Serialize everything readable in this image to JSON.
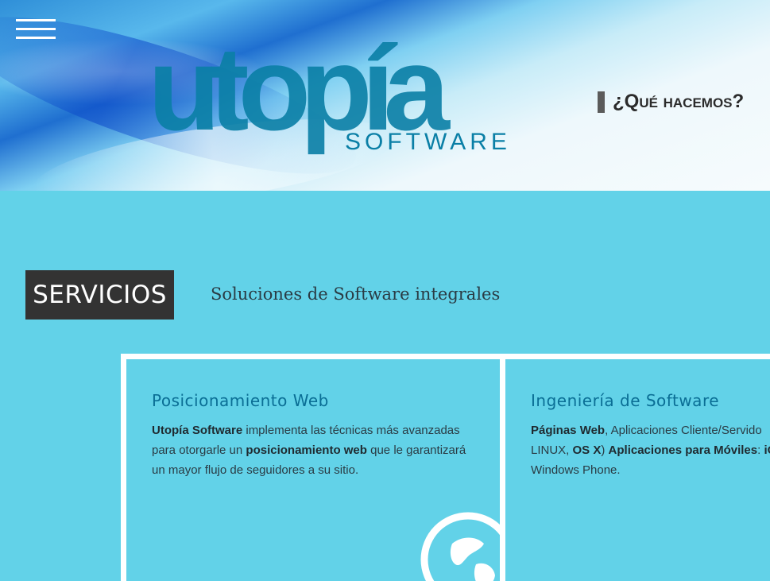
{
  "header": {
    "menu_icon": "hamburger-menu-icon",
    "logo_word": "utopía",
    "logo_sub": "SOFTWARE",
    "nav_link": "¿Qué hacemos?"
  },
  "services": {
    "title": "SERVICIOS",
    "subtitle": "Soluciones de Software integrales",
    "cards": [
      {
        "title": "Posicionamiento Web",
        "parts": [
          "Utopía Software",
          " implementa las técnicas más avanzadas para otorgarle un ",
          "posicionamiento web",
          " que le garantizará un mayor flujo de seguidores a su sitio."
        ],
        "icon": "globe-icon"
      },
      {
        "title": "Ingeniería de Software",
        "line1_parts": [
          "Páginas Web",
          ", Aplicaciones Cliente/Servido"
        ],
        "line2_parts": [
          "LINUX, ",
          "OS X",
          ") ",
          "Aplicaciones para Móviles",
          ": ",
          "iO"
        ],
        "line3": "Windows Phone."
      }
    ]
  },
  "colors": {
    "background": "#62d2e8",
    "title_box": "#333333",
    "card_title": "#0a6e95",
    "logo": "#0a7fa6"
  }
}
